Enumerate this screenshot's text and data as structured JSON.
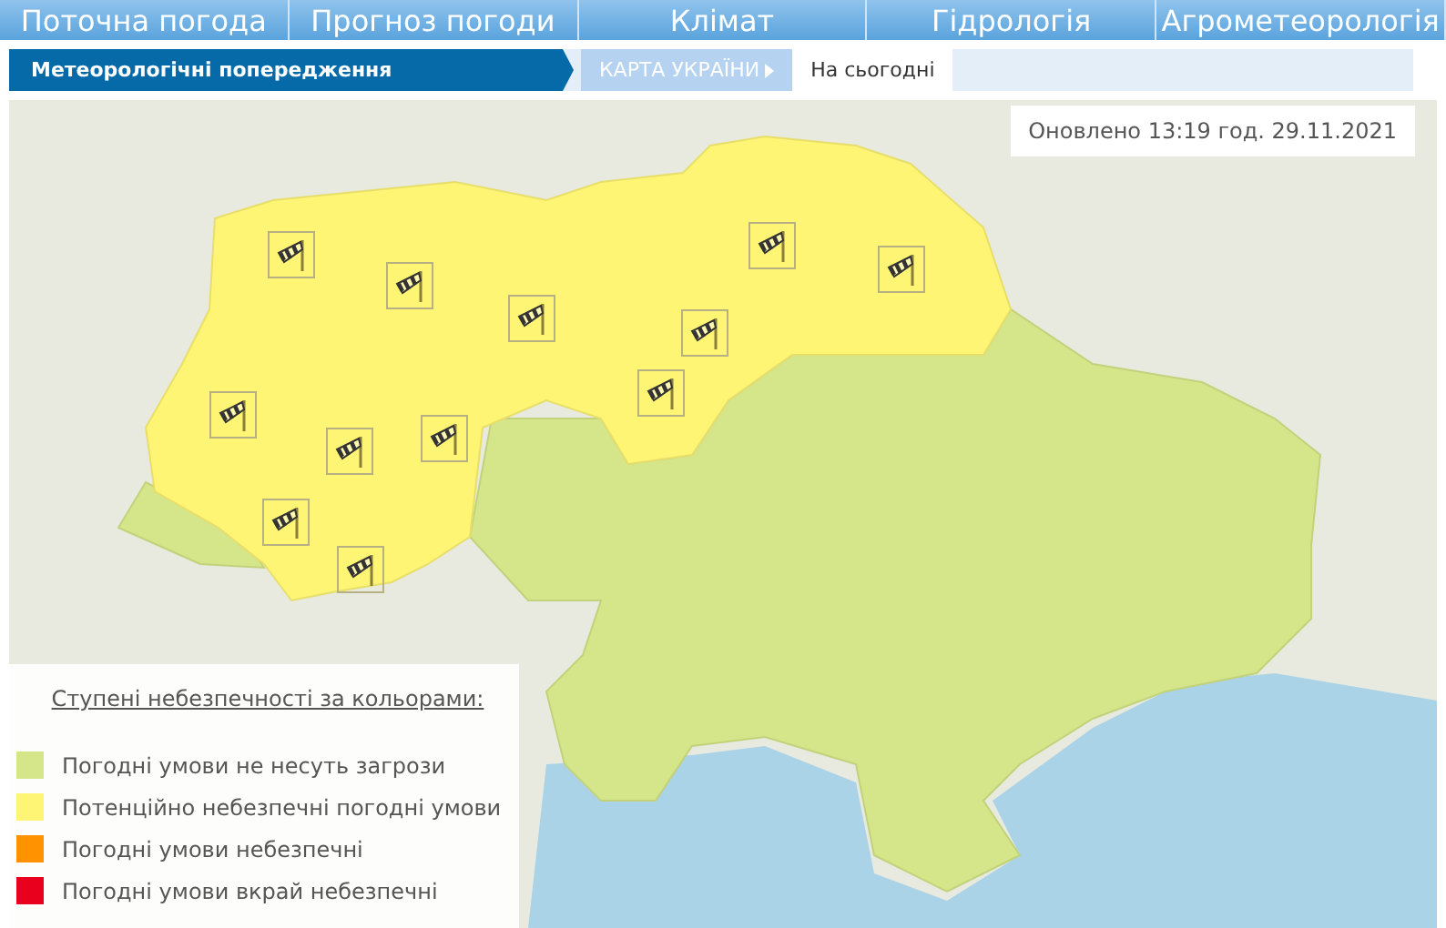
{
  "nav": [
    {
      "label": "Поточна погода"
    },
    {
      "label": "Прогноз погоди"
    },
    {
      "label": "Клімат"
    },
    {
      "label": "Гідрологія"
    },
    {
      "label": "Агрометеорологія"
    }
  ],
  "subnav": {
    "title": "Метеорологічні попередження",
    "crumbs": [
      {
        "label": "КАРТА УКРАЇНИ",
        "kind": "link"
      },
      {
        "label": "На сьогодні",
        "kind": "current"
      }
    ]
  },
  "map": {
    "updated": "Оновлено 13:19 год. 29.11.2021"
  },
  "legend": {
    "title": "Ступені небезпечності за кольорами:",
    "items": [
      {
        "label": "Погодні умови не несуть загрози",
        "color": "#d4e58a"
      },
      {
        "label": "Потенційно небезпечні погодні умови",
        "color": "#fff575"
      },
      {
        "label": "Погодні умови небезпечні",
        "color": "#ff9200"
      },
      {
        "label": "Погодні умови вкрай небезпечні",
        "color": "#e8001c"
      }
    ]
  }
}
